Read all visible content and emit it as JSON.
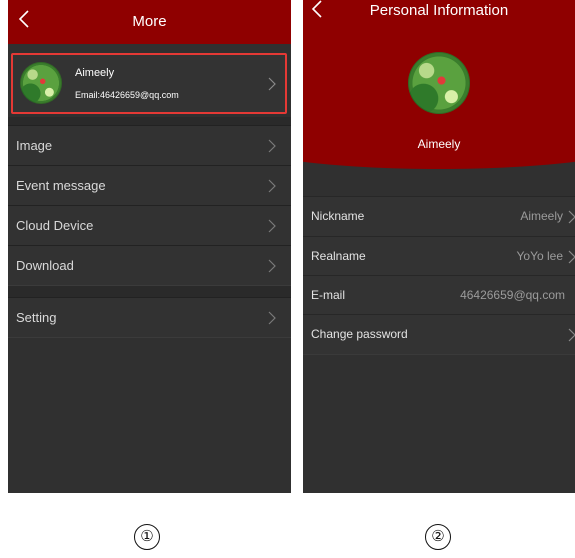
{
  "screen1": {
    "title": "More",
    "profile": {
      "name": "Aimeely",
      "email": "Email:46426659@qq.com"
    },
    "menu": [
      {
        "label": "Image"
      },
      {
        "label": "Event message"
      },
      {
        "label": "Cloud Device"
      },
      {
        "label": "Download"
      },
      {
        "label": "Setting"
      }
    ]
  },
  "screen2": {
    "title": "Personal Information",
    "name": "Aimeely",
    "rows": [
      {
        "label": "Nickname",
        "value": "Aimeely"
      },
      {
        "label": "Realname",
        "value": "YoYo lee"
      },
      {
        "label": "E-mail",
        "value": "46426659@qq.com"
      },
      {
        "label": "Change password",
        "value": ""
      }
    ]
  },
  "labels": {
    "step1": "①",
    "step2": "②"
  },
  "colors": {
    "header": "#8f0000",
    "background": "#303030",
    "highlight_border": "#e53935"
  }
}
